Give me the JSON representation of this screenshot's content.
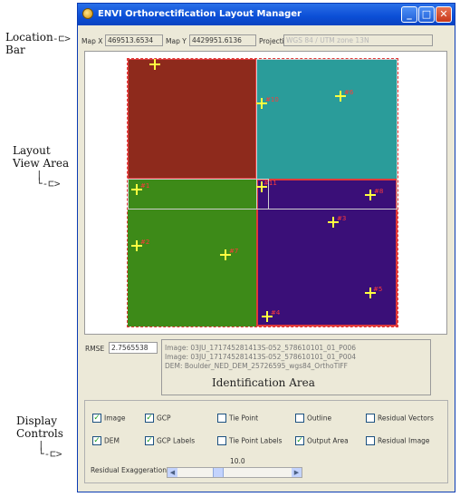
{
  "callouts": {
    "location_bar": [
      "Location",
      "Bar"
    ],
    "layout_view_area": [
      "Layout",
      "View Area"
    ],
    "display_controls": [
      "Display",
      "Controls"
    ]
  },
  "window": {
    "title": "ENVI Orthorectification Layout Manager",
    "min_label": "_",
    "max_label": "□",
    "close_label": "✕"
  },
  "location_bar": {
    "map_x_label": "Map X",
    "map_x_value": "469513.6534",
    "map_y_label": "Map Y",
    "map_y_value": "4429951.6136",
    "projection_label": "Projection",
    "projection_value": "WGS 84 / UTM zone 13N"
  },
  "layout_view": {
    "gcp_labels": [
      "#1",
      "#2",
      "#3",
      "#4",
      "#5",
      "#6",
      "#7",
      "#8",
      "#9",
      "#10",
      "#11"
    ],
    "colors": {
      "red": "#8e2a1c",
      "teal": "#2a9c9a",
      "green": "#3d8a18",
      "purple": "#3a0f78",
      "gcp": "#ffff40",
      "outline": "#e03a3a"
    }
  },
  "identification": {
    "rmse_label": "RMSE",
    "rmse_value": "2.7565538",
    "lines": [
      "Image: 03JU_171745281413S-052_578610101_01_P006",
      "Image: 03JU_171745281413S-052_578610101_01_P004",
      "DEM: Boulder_NED_DEM_25726595_wgs84_OrthoTIFF"
    ],
    "area_label": "Identification Area"
  },
  "display_controls": {
    "checkboxes": [
      {
        "label": "Image",
        "checked": true
      },
      {
        "label": "GCP",
        "checked": true
      },
      {
        "label": "Tie Point",
        "checked": false
      },
      {
        "label": "Outline",
        "checked": false
      },
      {
        "label": "Residual Vectors",
        "checked": false
      },
      {
        "label": "DEM",
        "checked": true
      },
      {
        "label": "GCP Labels",
        "checked": true
      },
      {
        "label": "Tie Point Labels",
        "checked": false
      },
      {
        "label": "Output Area",
        "checked": true
      },
      {
        "label": "Residual Image",
        "checked": false
      }
    ],
    "residual_label": "Residual Exaggeration",
    "residual_value": "10.0"
  }
}
